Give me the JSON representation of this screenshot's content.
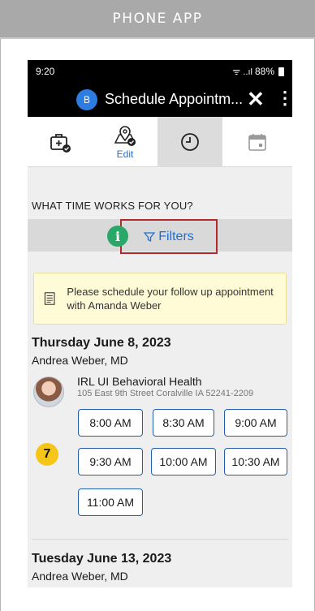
{
  "banner": {
    "label": "PHONE APP"
  },
  "status_bar": {
    "time": "9:20",
    "signal": "ᯤ ..ıl",
    "battery": "88%"
  },
  "app_bar": {
    "avatar_initial": "B",
    "title": "Schedule Appointm...",
    "close": "✕",
    "menu": "⋮"
  },
  "tabs": [
    {
      "icon": "medical-kit-icon",
      "label": ""
    },
    {
      "icon": "location-pin-icon",
      "label": "Edit"
    },
    {
      "icon": "clock-icon",
      "label": ""
    },
    {
      "icon": "calendar-icon",
      "label": ""
    }
  ],
  "question": "WHAT TIME WORKS FOR YOU?",
  "filters": {
    "label": "Filters",
    "info_badge": "i"
  },
  "notice": {
    "text": "Please schedule your follow up appointment with Amanda Weber"
  },
  "days": [
    {
      "date": "Thursday June 8, 2023",
      "doctor": "Andrea Weber, MD",
      "clinic": "IRL UI Behavioral Health",
      "address": "105 East 9th Street Coralville IA 52241-2209",
      "slots": [
        "8:00 AM",
        "8:30 AM",
        "9:00 AM",
        "9:30 AM",
        "10:00 AM",
        "10:30 AM",
        "11:00 AM"
      ]
    },
    {
      "date": "Tuesday June 13, 2023",
      "doctor": "Andrea Weber, MD"
    }
  ],
  "callout_badge": "7",
  "colors": {
    "accent_blue": "#1f6fd1",
    "highlight_red": "#b22a2a",
    "info_green": "#2aa86a",
    "callout_yellow": "#f5c518",
    "notice_bg": "#fffbd6"
  }
}
